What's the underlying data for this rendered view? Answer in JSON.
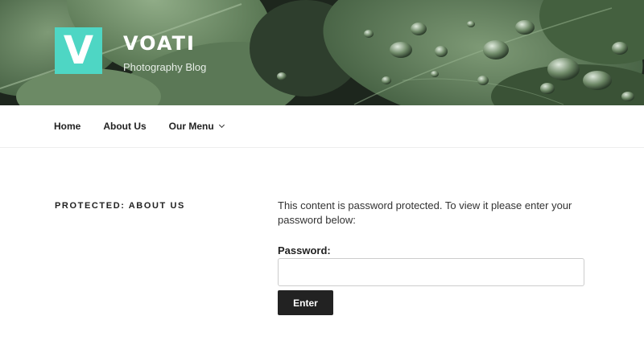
{
  "header": {
    "logo_letter": "V",
    "site_title": "VOATI",
    "site_description": "Photography Blog",
    "accent_color": "#4ed6c4"
  },
  "nav": {
    "items": [
      {
        "label": "Home"
      },
      {
        "label": "About Us"
      },
      {
        "label": "Our Menu",
        "icon": "chevron-down-icon"
      }
    ]
  },
  "main": {
    "entry_title": "PROTECTED: ABOUT US",
    "notice": "This content is password protected. To view it please enter your password below:",
    "password_label": "Password:",
    "password_value": "",
    "submit_label": "Enter"
  }
}
